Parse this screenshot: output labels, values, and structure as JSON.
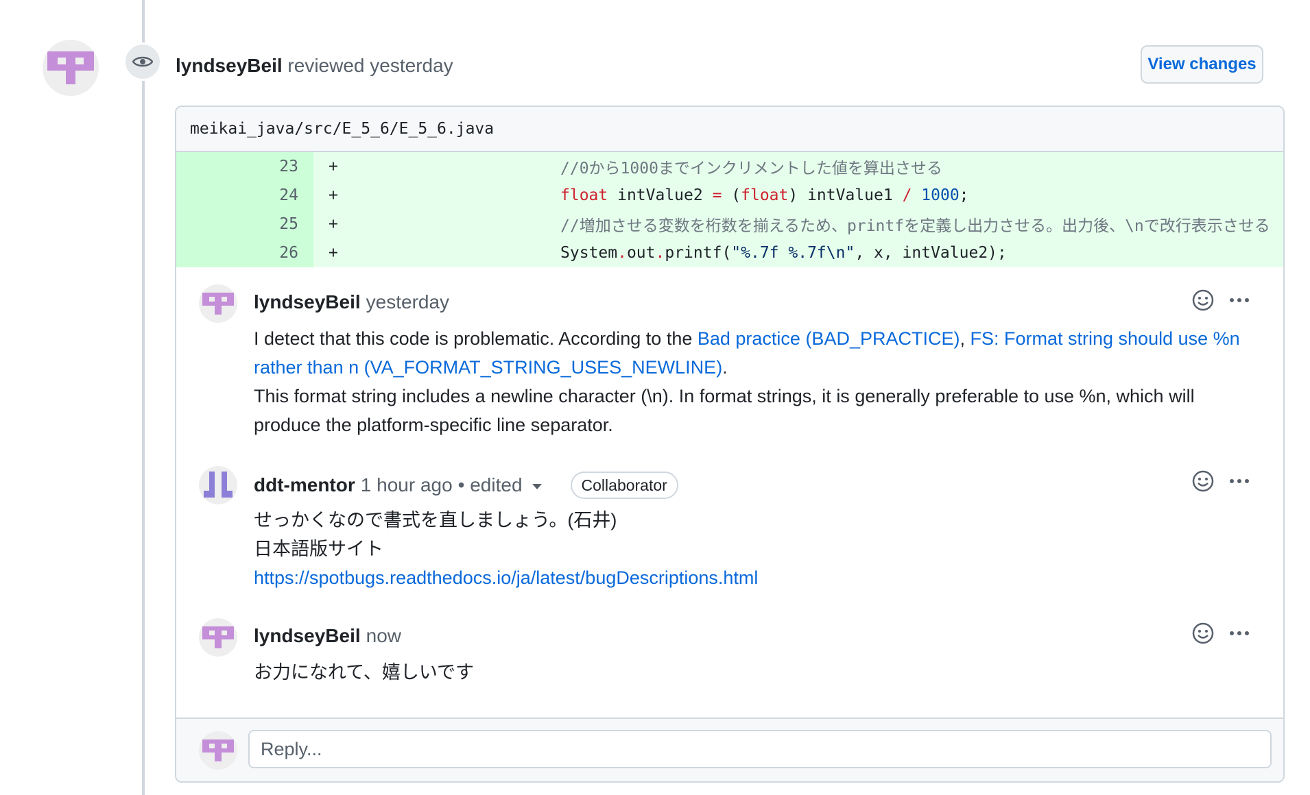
{
  "review": {
    "author": "lyndseyBeil",
    "action": "reviewed",
    "time": "yesterday",
    "view_changes_label": "View changes",
    "avatar_icon": "identicon-avatar",
    "event_icon": "eye-icon"
  },
  "file": {
    "path": "meikai_java/src/E_5_6/E_5_6.java",
    "lines": [
      {
        "number": "23",
        "sign": "+",
        "tokens": [
          {
            "t": "comment",
            "v": "//0から1000までインクリメントした値を算出させる"
          }
        ]
      },
      {
        "number": "24",
        "sign": "+",
        "tokens": [
          {
            "t": "kw",
            "v": "float"
          },
          {
            "t": "plain",
            "v": " intValue2 "
          },
          {
            "t": "op",
            "v": "="
          },
          {
            "t": "plain",
            "v": " ("
          },
          {
            "t": "kw",
            "v": "float"
          },
          {
            "t": "plain",
            "v": ") intValue1 "
          },
          {
            "t": "op",
            "v": "/"
          },
          {
            "t": "plain",
            "v": " "
          },
          {
            "t": "num",
            "v": "1000"
          },
          {
            "t": "plain",
            "v": ";"
          }
        ]
      },
      {
        "number": "25",
        "sign": "+",
        "tokens": [
          {
            "t": "comment",
            "v": "//増加させる変数を桁数を揃えるため、printfを定義し出力させる。出力後、\\nで改行表示させる"
          }
        ]
      },
      {
        "number": "26",
        "sign": "+",
        "tokens": [
          {
            "t": "plain",
            "v": "System"
          },
          {
            "t": "op",
            "v": "."
          },
          {
            "t": "plain",
            "v": "out"
          },
          {
            "t": "op",
            "v": "."
          },
          {
            "t": "plain",
            "v": "printf("
          },
          {
            "t": "str",
            "v": "\"%.7f     %.7f\\n\""
          },
          {
            "t": "plain",
            "v": ", x, intValue2);"
          }
        ]
      }
    ]
  },
  "comments": [
    {
      "author": "lyndseyBeil",
      "time": "yesterday",
      "body_intro": "I detect that this code is problematic. According to the ",
      "link1": "Bad practice (BAD_PRACTICE)",
      "sep": ", ",
      "link2": "FS: Format string should use %n rather than n (VA_FORMAT_STRING_USES_NEWLINE)",
      "end": ".",
      "body_rest": "This format string includes a newline character (\\n). In format strings, it is generally preferable to use %n, which will produce the platform-specific line separator."
    },
    {
      "author": "ddt-mentor",
      "time": "1 hour ago",
      "edited": "• edited",
      "badge": "Collaborator",
      "line1": "せっかくなので書式を直しましょう。(石井)",
      "line2": "日本語版サイト",
      "link": "https://spotbugs.readthedocs.io/ja/latest/bugDescriptions.html"
    },
    {
      "author": "lyndseyBeil",
      "time": "now",
      "body": "お力になれて、嬉しいです"
    }
  ],
  "reply": {
    "placeholder": "Reply..."
  },
  "colors": {
    "link": "#0969da",
    "added_bg": "#e6ffec",
    "added_gutter": "#ccffd8",
    "keyword": "#cf222e",
    "number": "#0550ae",
    "avatar_purple": "#c48ed9",
    "avatar_violet": "#8b7fd8"
  }
}
